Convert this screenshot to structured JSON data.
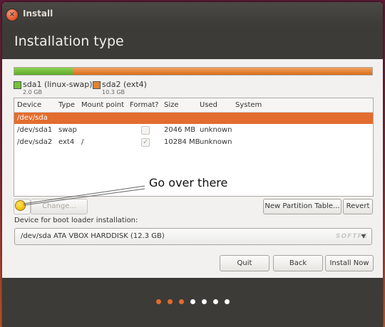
{
  "window": {
    "title": "Install",
    "close_glyph": "×"
  },
  "header": {
    "title": "Installation type"
  },
  "partitions_bar": {
    "segments": [
      {
        "name": "sda1 (linux-swap)",
        "size": "2.0 GB",
        "color": "#73c23a",
        "fraction": 0.163
      },
      {
        "name": "sda2 (ext4)",
        "size": "10.3 GB",
        "color": "#e2832f",
        "fraction": 0.837
      }
    ]
  },
  "table": {
    "headers": [
      "Device",
      "Type",
      "Mount point",
      "Format?",
      "Size",
      "Used",
      "System"
    ],
    "rows": [
      {
        "device": "/dev/sda",
        "type": "",
        "mount": "",
        "format": null,
        "size": "",
        "used": "",
        "system": "",
        "selected": true
      },
      {
        "device": "/dev/sda1",
        "type": "swap",
        "mount": "",
        "format": false,
        "size": "2046 MB",
        "used": "unknown",
        "system": "",
        "selected": false
      },
      {
        "device": "/dev/sda2",
        "type": "ext4",
        "mount": "/",
        "format": true,
        "size": "10284 MB",
        "used": "unknown",
        "system": "",
        "selected": false
      }
    ]
  },
  "buttons": {
    "change": "Change...",
    "new_table": "New Partition Table...",
    "revert": "Revert",
    "quit": "Quit",
    "back": "Back",
    "install": "Install Now"
  },
  "annotation": {
    "text": "Go over there"
  },
  "boot_loader": {
    "label": "Device for boot loader installation:",
    "selected": "/dev/sda   ATA VBOX HARDDISK (12.3 GB)"
  },
  "progress": {
    "total_steps": 7,
    "completed_steps": 3,
    "active_color": "#e26d2f",
    "inactive_color": "#ffffff"
  },
  "watermark": "SOFTPE"
}
